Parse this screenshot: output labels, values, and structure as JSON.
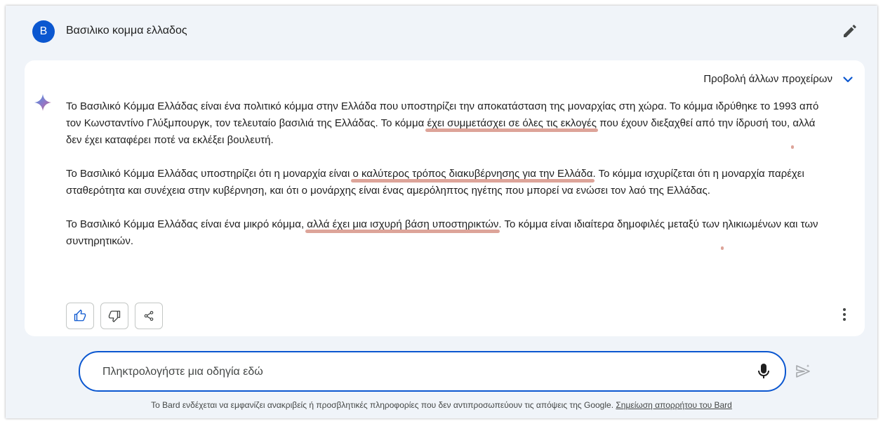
{
  "header": {
    "avatar_letter": "B",
    "prompt": "Βασιλικο κομμα ελλαδος",
    "edit_icon": "pencil-icon"
  },
  "response": {
    "drafts_label": "Προβολή άλλων προχείρων",
    "drafts_icon": "chevron-down-icon",
    "logo_icon": "sparkle-icon",
    "p1": {
      "a": "Το Βασιλικό Κόμμα Ελλάδας είναι ένα πολιτικό κόμμα στην Ελλάδα που υποστηρίζει την αποκατάσταση της μοναρχίας στη χώρα. Το κόμμα ιδρύθηκε το 1993 από τον Κωνσταντίνο Γλύξμπουργκ, τον τελευταίο βασιλιά της Ελλάδας. Το κόμμα ",
      "b": "έχει συμμετάσχει σε όλες τις εκλογές",
      "c": " που έχουν διεξαχθεί από την ίδρυσή του, ",
      "d": "αλλά δεν έχει καταφέρει ποτέ να εκλέξει βουλευτή",
      "e": "."
    },
    "p2": {
      "a": "Το Βασιλικό Κόμμα Ελλάδας υποστηρίζει ότι η μοναρχία είναι ",
      "b": "ο καλύτερος τρόπος διακυβέρνησης για την Ελλάδα",
      "c": ". Το κόμμα ισχυρίζεται ότι η μοναρχία παρέχει σταθερότητα και συνέχεια στην κυβέρνηση, και ότι ο μονάρχης είναι ένας αμερόληπτος ηγέτης που μπορεί να ενώσει τον λαό της Ελλάδας."
    },
    "p3": {
      "a": "Το Βασιλικό Κόμμα Ελλάδας είναι ένα μικρό κόμμα, ",
      "b": "αλλά έχει μια ισχυρή βάση υποστηρικτών",
      "c": ". Το κόμμα είναι ιδιαίτερα δημοφιλές μεταξύ των ",
      "d": "ηλικιωμένων και των συντηρητικών",
      "e": "."
    },
    "actions": [
      "thumbs-up-icon",
      "thumbs-down-icon",
      "share-icon",
      "more-vert-icon"
    ]
  },
  "input": {
    "placeholder": "Πληκτρολογήστε μια οδηγία εδώ",
    "mic_icon": "microphone-icon",
    "send_icon": "send-icon"
  },
  "footer": {
    "text": "Το Bard ενδέχεται να εμφανίζει ανακριβείς ή προσβλητικές πληροφορίες που δεν αντιπροσωπεύουν τις απόψεις της Google. ",
    "link": "Σημείωση απορρήτου του Bard"
  },
  "colors": {
    "accent": "#0b57d0",
    "background": "#f0f4f9",
    "highlight": "#d99a8e"
  }
}
